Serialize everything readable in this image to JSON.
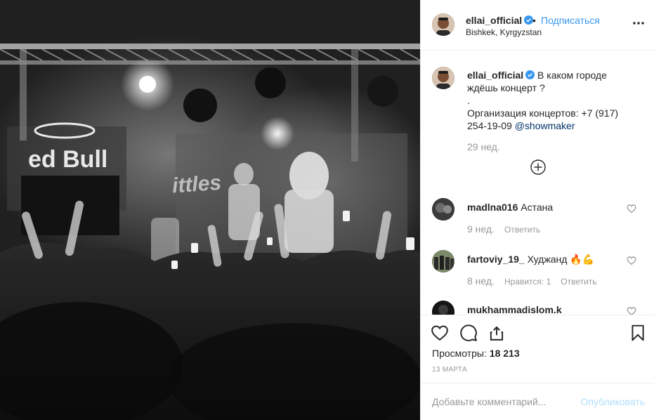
{
  "post": {
    "username": "ellai_official",
    "follow_label": "Подписаться",
    "dot": "•",
    "location": "Bishkek, Kyrgyzstan"
  },
  "caption": {
    "username": "ellai_official",
    "line1": "В каком городе",
    "line2": "ждёшь концерт ?",
    "line3": ".",
    "line4": "Организация концертов: +7 (917)",
    "line5_prefix": "254-19-09 ",
    "line5_link": "@showmaker",
    "time": "29 нед."
  },
  "comments": [
    {
      "username": "madlna016",
      "text": "Астана",
      "time": "9 нед.",
      "likes": "",
      "reply": "Ответить"
    },
    {
      "username": "fartoviy_19_",
      "text": "Худжанд 🔥💪",
      "time": "8 нед.",
      "likes": "Нравится: 1",
      "reply": "Ответить"
    },
    {
      "username": "mukhammadislom.k",
      "text": "",
      "time": "",
      "likes": "",
      "reply": ""
    }
  ],
  "media": {
    "brand_text": "ed Bull",
    "banner_text": "ittles"
  },
  "stats": {
    "views_label": "Просмотры:",
    "views_value": "18 213",
    "date": "13 МАРТА"
  },
  "add_comment": {
    "placeholder": "Добавьте комментарий...",
    "post_label": "Опубликовать"
  },
  "icons": {
    "verified": "verified-badge-icon",
    "more": "more-options-icon",
    "like": "heart-icon",
    "comment": "comment-icon",
    "share": "share-icon",
    "save": "bookmark-icon",
    "load_more": "load-more-icon"
  },
  "colors": {
    "accent": "#3897f0",
    "link": "#003569",
    "muted": "#999999",
    "post_disabled": "#b2dffc"
  }
}
